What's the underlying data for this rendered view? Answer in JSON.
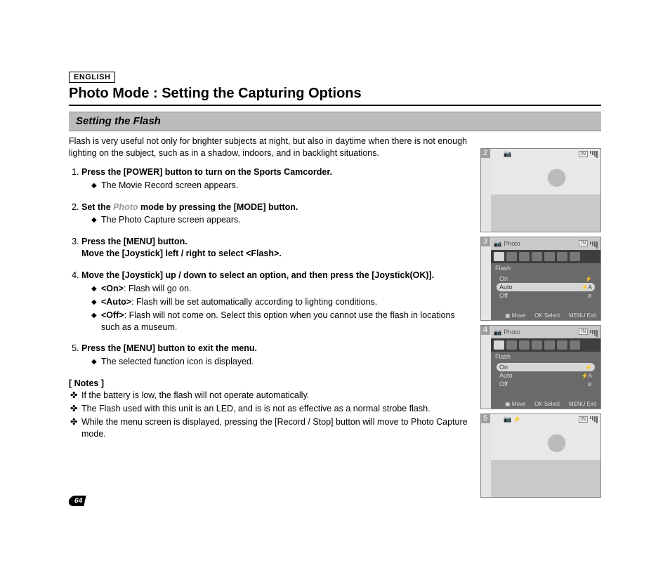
{
  "lang": "ENGLISH",
  "title": "Photo Mode : Setting the Capturing Options",
  "subheading": "Setting the Flash",
  "intro": "Flash is very useful not only for brighter subjects at night, but also in daytime when there is not enough lighting on the subject, such as in a shadow, indoors, and in backlight situations.",
  "steps": {
    "s1": {
      "head": "Press the [POWER] button to turn on the Sports Camcorder.",
      "bul1": "The Movie Record screen appears."
    },
    "s2": {
      "head_pre": "Set the ",
      "head_gray": "Photo",
      "head_post": " mode by pressing the [MODE] button.",
      "bul1": "The Photo Capture screen appears."
    },
    "s3": {
      "line1": "Press the [MENU] button.",
      "line2": "Move the [Joystick] left / right to select <Flash>."
    },
    "s4": {
      "head": "Move the [Joystick] up / down to select an option, and then press the [Joystick(OK)].",
      "b1_label": "<On>",
      "b1_text": ": Flash will go on.",
      "b2_label": "<Auto>",
      "b2_text": ": Flash will be set automatically according to lighting conditions.",
      "b3_label": "<Off>",
      "b3_text": ": Flash will not come on. Select this option when you cannot use the flash in locations such as a museum."
    },
    "s5": {
      "head": "Press the [MENU] button to exit the menu.",
      "bul1": "The selected function icon is displayed."
    }
  },
  "notes_head": "[ Notes ]",
  "notes": {
    "n1": "If the battery is low, the flash will not operate automatically.",
    "n2": "The Flash used with this unit is an LED, and is is not as effective as a normal strobe flash.",
    "n3": "While the menu screen is displayed, pressing the [Record / Stop] button will move to Photo Capture mode."
  },
  "figures": {
    "f2": {
      "num": "2"
    },
    "f3": {
      "num": "3",
      "header": "Photo",
      "label": "Flash",
      "opt1": "On",
      "opt2": "Auto",
      "opt3": "Off",
      "move": "Move",
      "select": "Select",
      "exit": "Exit",
      "ok": "OK",
      "menu": "MENU",
      "in": "IN"
    },
    "f4": {
      "num": "4",
      "header": "Photo",
      "label": "Flash",
      "opt1": "On",
      "opt2": "Auto",
      "opt3": "Off",
      "move": "Move",
      "select": "Select",
      "exit": "Exit",
      "ok": "OK",
      "menu": "MENU",
      "in": "IN"
    },
    "f5": {
      "num": "5",
      "in": "IN"
    }
  },
  "page_number": "64"
}
